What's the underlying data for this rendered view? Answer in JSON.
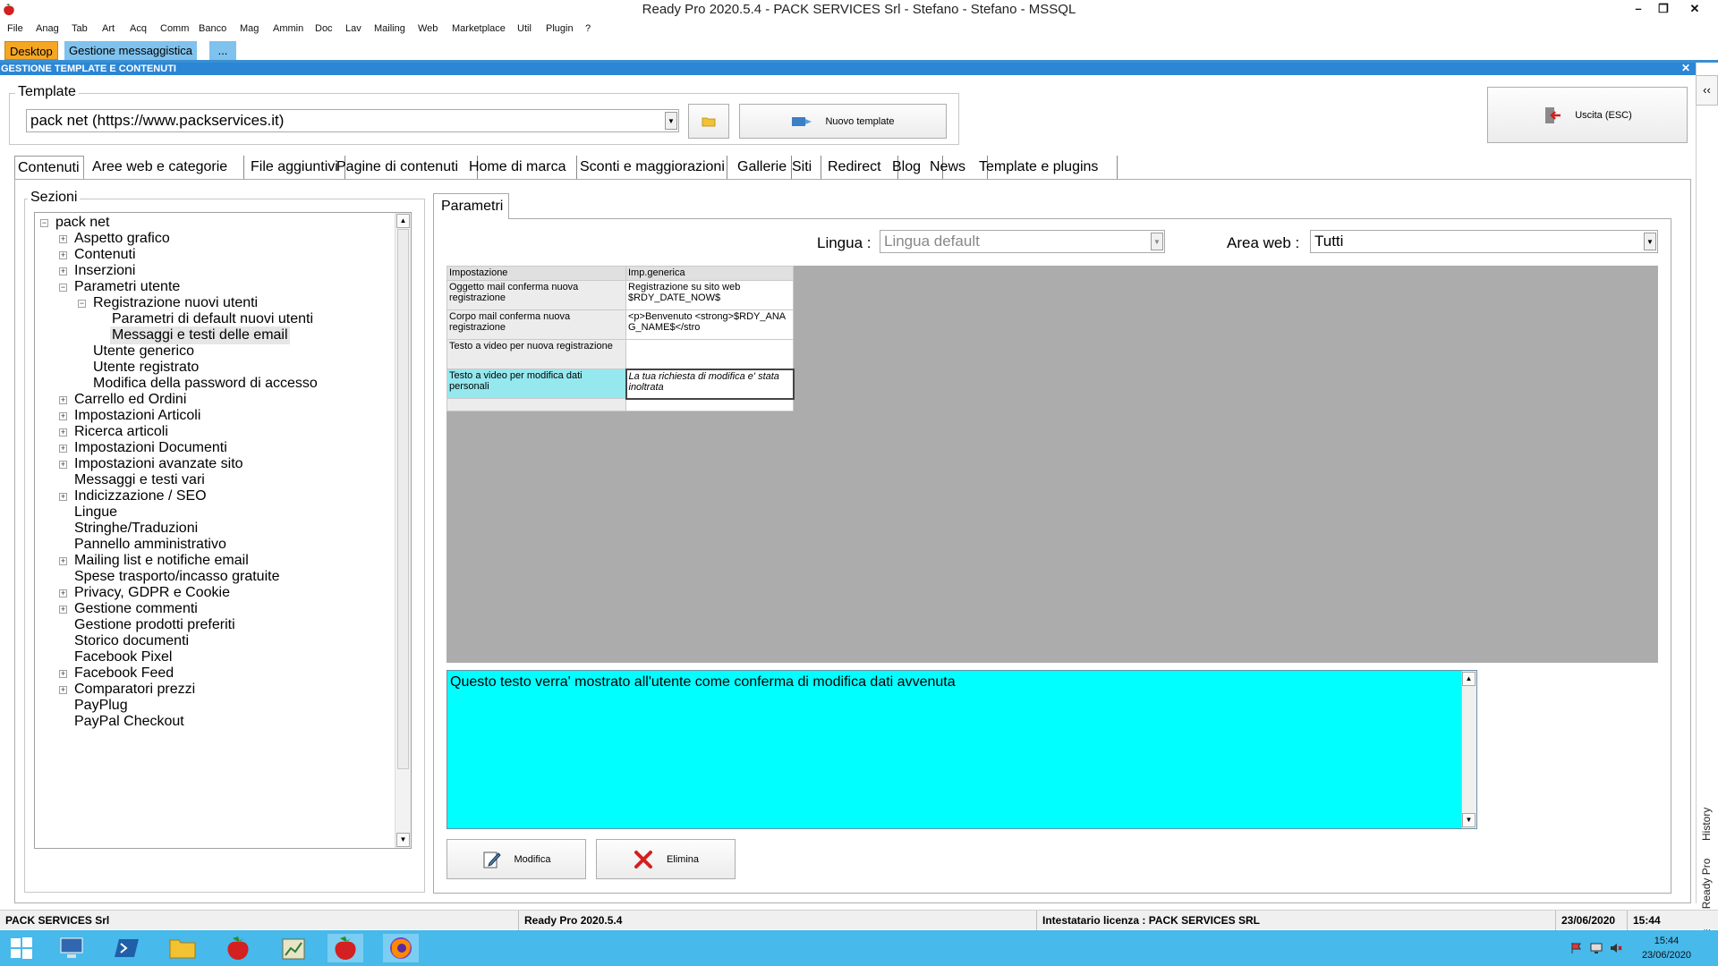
{
  "window": {
    "title": "Ready Pro 2020.5.4 - PACK SERVICES Srl - Stefano - Stefano - MSSQL",
    "controls": [
      "–",
      "❐",
      "✕"
    ]
  },
  "menu": [
    "File",
    "Anag",
    "Tab",
    "Art",
    "Acq",
    "Comm",
    "Banco",
    "Mag",
    "Ammin",
    "Doc",
    "Lav",
    "Mailing",
    "Web",
    "Marketplace",
    "Util",
    "Plugin",
    "?"
  ],
  "doc_tabs": {
    "desktop": "Desktop",
    "messaggistica": "Gestione messaggistica",
    "more": "..."
  },
  "section_header": {
    "title": "GESTIONE TEMPLATE E CONTENUTI",
    "close": "✕"
  },
  "template": {
    "group_label": "Template",
    "selected": "pack net (https://www.packservices.it)",
    "new_button": "Nuovo template",
    "exit_button": "Uscita (ESC)"
  },
  "main_tabs": [
    "Contenuti",
    "Aree web e categorie",
    "File aggiuntivi",
    "Pagine di contenuti",
    "Home di marca",
    "Sconti e maggiorazioni",
    "Gallerie",
    "Siti",
    "Redirect",
    "Blog",
    "News",
    "Template e plugins"
  ],
  "sections": {
    "label": "Sezioni",
    "tree": [
      {
        "label": "pack net",
        "level": 0,
        "expander": "−"
      },
      {
        "label": "Aspetto grafico",
        "level": 1,
        "expander": "+"
      },
      {
        "label": "Contenuti",
        "level": 1,
        "expander": "+"
      },
      {
        "label": "Inserzioni",
        "level": 1,
        "expander": "+"
      },
      {
        "label": "Parametri utente",
        "level": 1,
        "expander": "−"
      },
      {
        "label": "Registrazione nuovi utenti",
        "level": 2,
        "expander": "−"
      },
      {
        "label": "Parametri di default nuovi utenti",
        "level": 3,
        "expander": ""
      },
      {
        "label": "Messaggi e testi delle email",
        "level": 3,
        "expander": "",
        "selected": true
      },
      {
        "label": "Utente generico",
        "level": 2,
        "expander": ""
      },
      {
        "label": "Utente registrato",
        "level": 2,
        "expander": ""
      },
      {
        "label": "Modifica della password di accesso",
        "level": 2,
        "expander": ""
      },
      {
        "label": "Carrello ed Ordini",
        "level": 1,
        "expander": "+"
      },
      {
        "label": "Impostazioni Articoli",
        "level": 1,
        "expander": "+"
      },
      {
        "label": "Ricerca articoli",
        "level": 1,
        "expander": "+"
      },
      {
        "label": "Impostazioni Documenti",
        "level": 1,
        "expander": "+"
      },
      {
        "label": "Impostazioni avanzate sito",
        "level": 1,
        "expander": "+"
      },
      {
        "label": "Messaggi e testi vari",
        "level": 1,
        "expander": ""
      },
      {
        "label": "Indicizzazione / SEO",
        "level": 1,
        "expander": "+"
      },
      {
        "label": "Lingue",
        "level": 1,
        "expander": ""
      },
      {
        "label": "Stringhe/Traduzioni",
        "level": 1,
        "expander": ""
      },
      {
        "label": "Pannello amministrativo",
        "level": 1,
        "expander": ""
      },
      {
        "label": "Mailing list e notifiche email",
        "level": 1,
        "expander": "+"
      },
      {
        "label": "Spese trasporto/incasso gratuite",
        "level": 1,
        "expander": ""
      },
      {
        "label": "Privacy, GDPR e Cookie",
        "level": 1,
        "expander": "+"
      },
      {
        "label": "Gestione commenti",
        "level": 1,
        "expander": "+"
      },
      {
        "label": "Gestione prodotti preferiti",
        "level": 1,
        "expander": ""
      },
      {
        "label": "Storico documenti",
        "level": 1,
        "expander": ""
      },
      {
        "label": "Facebook Pixel",
        "level": 1,
        "expander": ""
      },
      {
        "label": "Facebook Feed",
        "level": 1,
        "expander": "+"
      },
      {
        "label": "Comparatori prezzi",
        "level": 1,
        "expander": "+"
      },
      {
        "label": "PayPlug",
        "level": 1,
        "expander": ""
      },
      {
        "label": "PayPal Checkout",
        "level": 1,
        "expander": ""
      }
    ]
  },
  "parametri": {
    "tab_label": "Parametri",
    "lingua_label": "Lingua :",
    "lingua_value": "Lingua default",
    "area_label": "Area web :",
    "area_value": "Tutti",
    "grid": {
      "headers": [
        "Impostazione",
        "Imp.generica"
      ],
      "rows": [
        {
          "key": "Oggetto mail conferma nuova registrazione",
          "value": "Registrazione su sito web $RDY_DATE_NOW$"
        },
        {
          "key": "Corpo mail conferma nuova registrazione",
          "value": "<p>Benvenuto <strong>$RDY_ANAG_NAME$</stro"
        },
        {
          "key": "Testo a video per nuova registrazione",
          "value": ""
        },
        {
          "key": "Testo a video per modifica dati personali",
          "value": "La tua richiesta di modifica e' stata inoltrata",
          "selected": true
        }
      ]
    },
    "description": "Questo testo verra' mostrato all'utente come conferma di modifica dati avvenuta",
    "modify_button": "Modifica",
    "delete_button": "Elimina"
  },
  "assistant": {
    "history_label": "History",
    "assistant_label": "Assistente Ready Pro",
    "collapse": "‹‹"
  },
  "statusbar": {
    "company": "PACK SERVICES Srl",
    "version": "Ready Pro 2020.5.4",
    "license": "Intestatario licenza : PACK SERVICES SRL",
    "date": "23/06/2020",
    "time": "15:44"
  },
  "taskbar": {
    "clock_time": "15:44",
    "clock_date": "23/06/2020"
  },
  "colors": {
    "accent_blue": "#2b86d6",
    "desktop_tab": "#f5a623",
    "taskbar": "#47b9ea",
    "description_bg": "#00ffff",
    "selected_row": "#94e8ee"
  }
}
